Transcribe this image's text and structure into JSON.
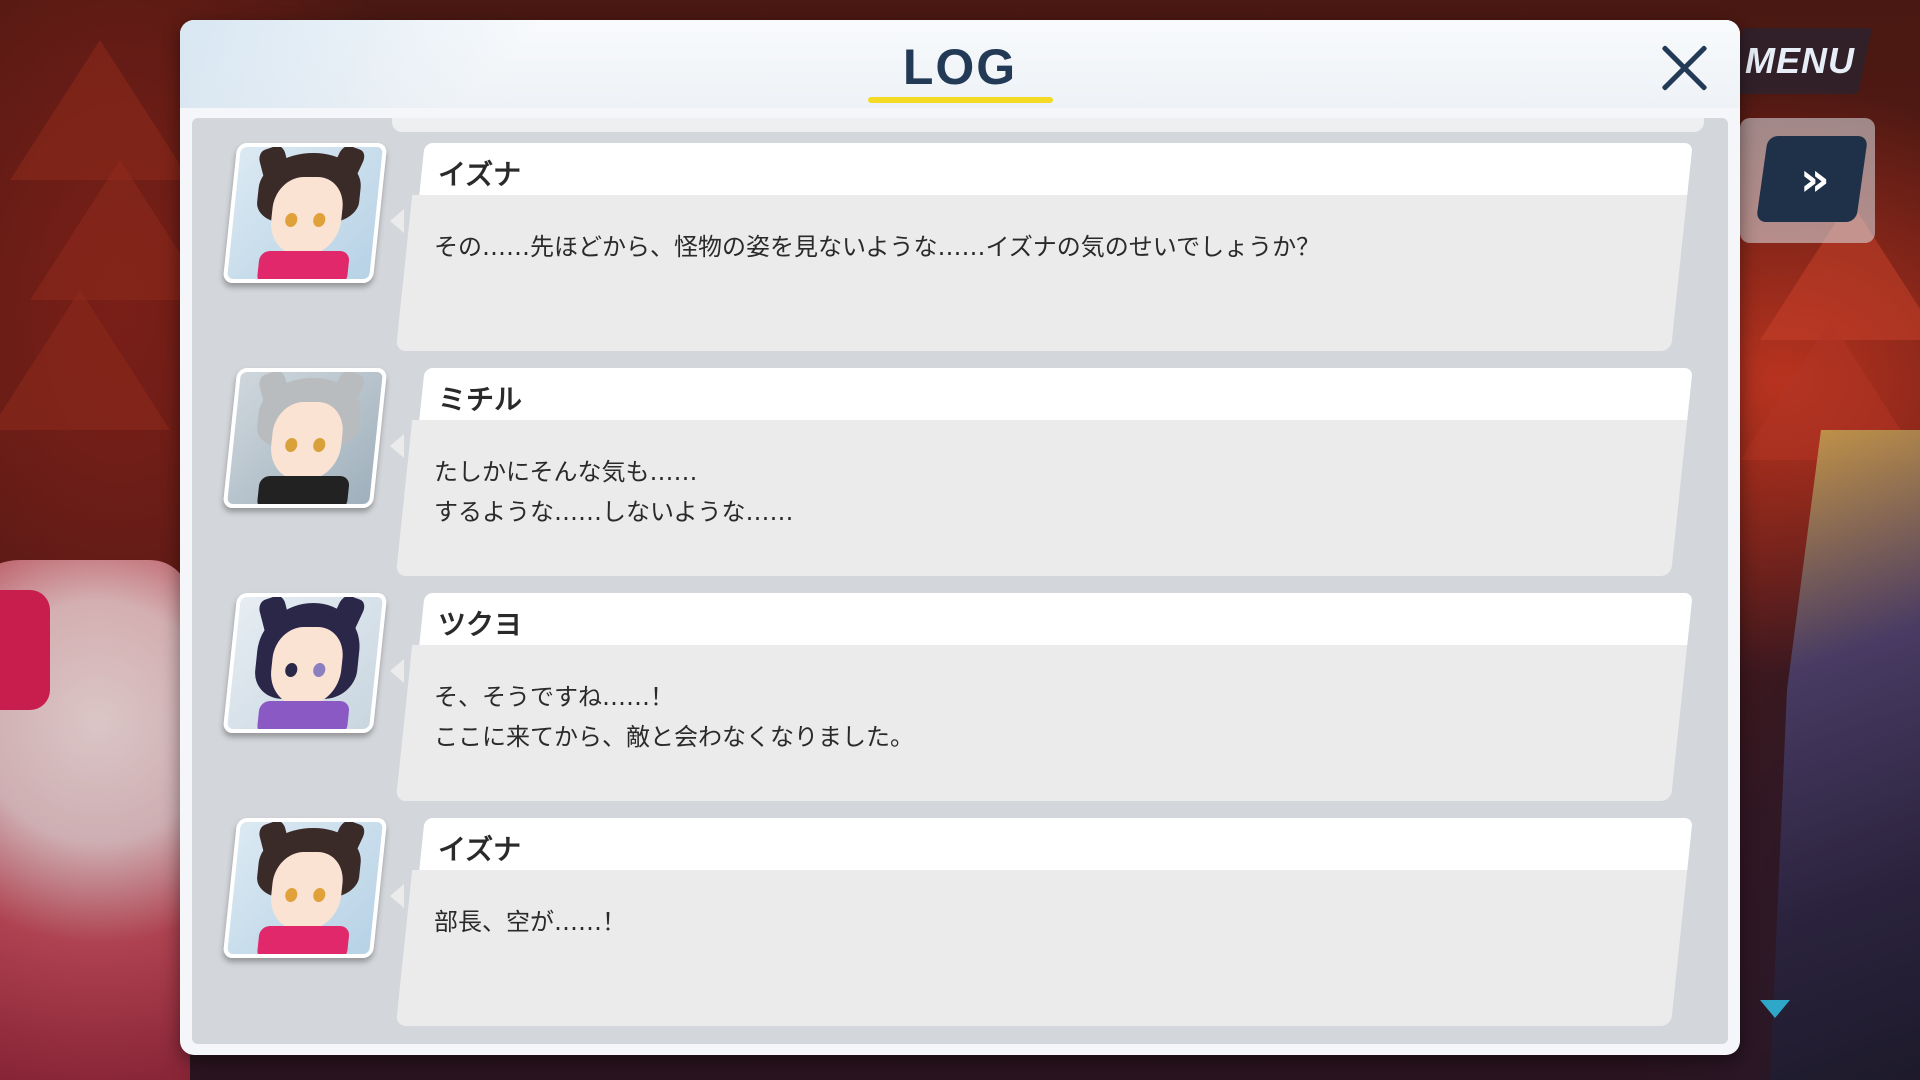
{
  "window": {
    "title": "LOG",
    "close_icon": "close-icon",
    "accent_color": "#f5da25",
    "title_color": "#233a57"
  },
  "hud": {
    "menu_label": "MENU",
    "fast_forward_label": "»",
    "scroll_down_icon": "triangle-down-icon"
  },
  "log": {
    "entries": [
      {
        "speaker": "イズナ",
        "avatar": "izuna-portrait",
        "lines": [
          "その……先ほどから、怪物の姿を見ないような……イズナの気のせいでしょうか？"
        ]
      },
      {
        "speaker": "ミチル",
        "avatar": "michiru-portrait",
        "lines": [
          "たしかにそんな気も……",
          "するような……しないような……"
        ]
      },
      {
        "speaker": "ツクヨ",
        "avatar": "tsukuyo-portrait",
        "lines": [
          "そ、そうですね……！",
          "ここに来てから、敵と会わなくなりました。"
        ]
      },
      {
        "speaker": "イズナ",
        "avatar": "izuna-portrait",
        "lines": [
          "部長、空が……！"
        ]
      }
    ]
  }
}
